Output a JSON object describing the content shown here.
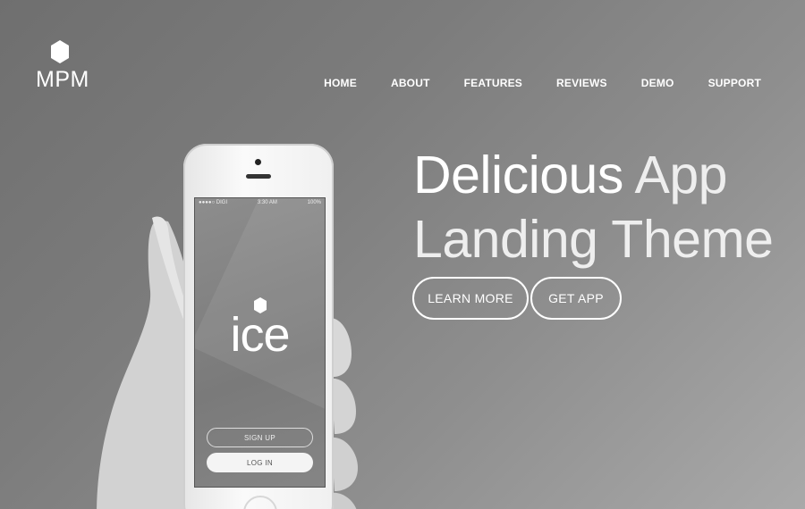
{
  "brand": {
    "name": "MPM"
  },
  "nav": {
    "items": [
      "HOME",
      "ABOUT",
      "FEATURES",
      "REVIEWS",
      "DEMO",
      "SUPPORT"
    ]
  },
  "hero": {
    "line1_strong": "Delicious",
    "line1_light": "App",
    "line2": "Landing Theme",
    "learn_more": "LEARN MORE",
    "get_app": "GET APP"
  },
  "phone": {
    "carrier": "●●●●○ DIGI",
    "time": "3:30 AM",
    "battery": "100%",
    "app_name": "ice",
    "sign_up": "SIGN UP",
    "log_in": "LOG IN"
  },
  "colors": {
    "text": "#ffffff",
    "background_dark": "#6f6f6f",
    "background_light": "#a9a9a9"
  }
}
